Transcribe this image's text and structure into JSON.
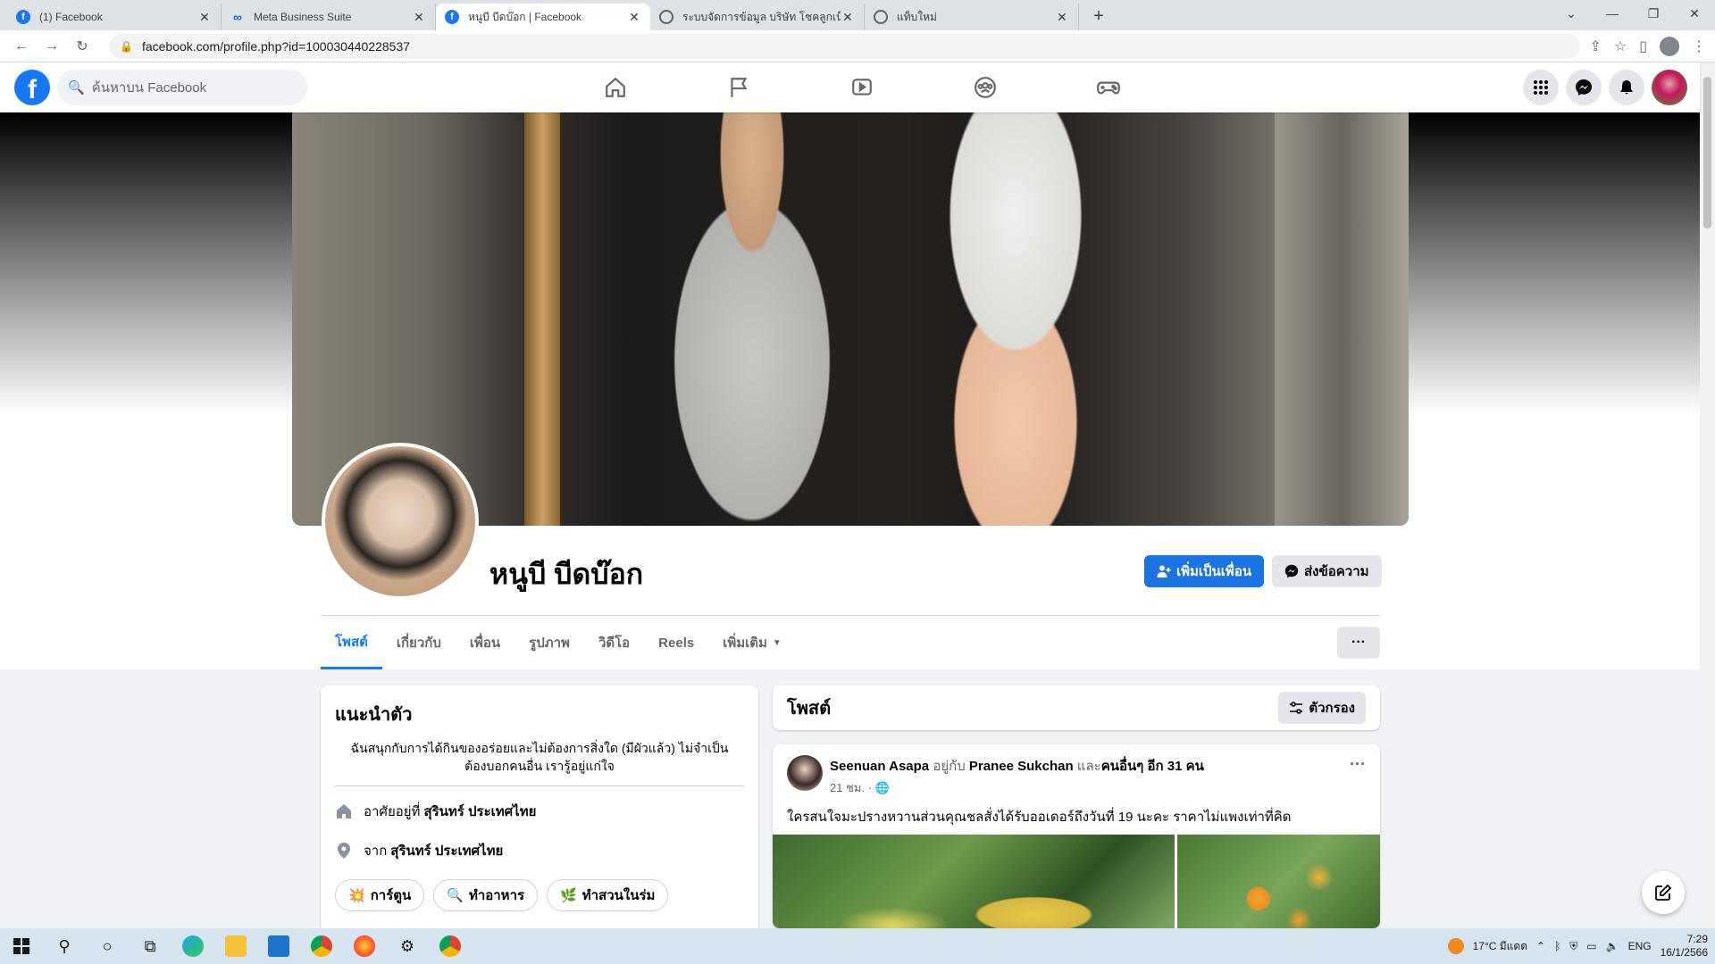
{
  "browser": {
    "tabs": [
      {
        "title": "(1) Facebook",
        "icon": "facebook-icon"
      },
      {
        "title": "Meta Business Suite",
        "icon": "meta-icon"
      },
      {
        "title": "หนูบี บีดบ๊อก | Facebook",
        "icon": "facebook-icon"
      },
      {
        "title": "ระบบจัดการข้อมูล บริษัท โชคลูกเน็ต ฯ",
        "icon": "globe-icon"
      },
      {
        "title": "แท็บใหม่",
        "icon": "globe-icon"
      }
    ],
    "url": "facebook.com/profile.php?id=100030440228537"
  },
  "fb": {
    "search_placeholder": "ค้นหาบน Facebook",
    "logo": "f"
  },
  "profile": {
    "name": "หนูบี บีดบ๊อก",
    "add_friend_label": "เพิ่มเป็นเพื่อน",
    "message_label": "ส่งข้อความ",
    "tabs": [
      "โพสต์",
      "เกี่ยวกับ",
      "เพื่อน",
      "รูปภาพ",
      "วิดีโอ",
      "Reels",
      "เพิ่มเติม"
    ],
    "more_label": "···"
  },
  "intro": {
    "title": "แนะนำตัว",
    "bio": "ฉันสนุกกับการได้กินของอร่อยและไม่ต้องการสิ่งใด (มีผัวแล้ว) ไม่จำเป็นต้องบอกคนอื่น เรารู้อยู่แก่ใจ",
    "lives_prefix": "อาศัยอยู่ที่",
    "lives_value": "สุรินทร์ ประเทศไทย",
    "from_prefix": "จาก",
    "from_value": "สุรินทร์ ประเทศไทย",
    "hobbies": [
      {
        "icon": "💥",
        "label": "การ์ตูน"
      },
      {
        "icon": "🔍",
        "label": "ทำอาหาร"
      },
      {
        "icon": "🌿",
        "label": "ทำสวนในร่ม"
      }
    ]
  },
  "posts": {
    "title": "โพสต์",
    "filter_label": "ตัวกรอง",
    "items": [
      {
        "author": "Seenuan Asapa",
        "with_word": "อยู่กับ",
        "with_name": "Pranee Sukchan",
        "and_word": "และ",
        "others": "คนอื่นๆ อีก 31 คน",
        "time": "21 ชม. ·",
        "text": "ใครสนใจมะปรางหวานส่วนคุณชลสั่งได้รับออเดอร์ถึงวันที่ 19 นะคะ ราคาไม่แพงเท่าที่คิด"
      }
    ]
  },
  "taskbar": {
    "weather": "17°C  มีแดด",
    "lang": "ENG",
    "time": "7:29",
    "date": "16/1/2566"
  }
}
